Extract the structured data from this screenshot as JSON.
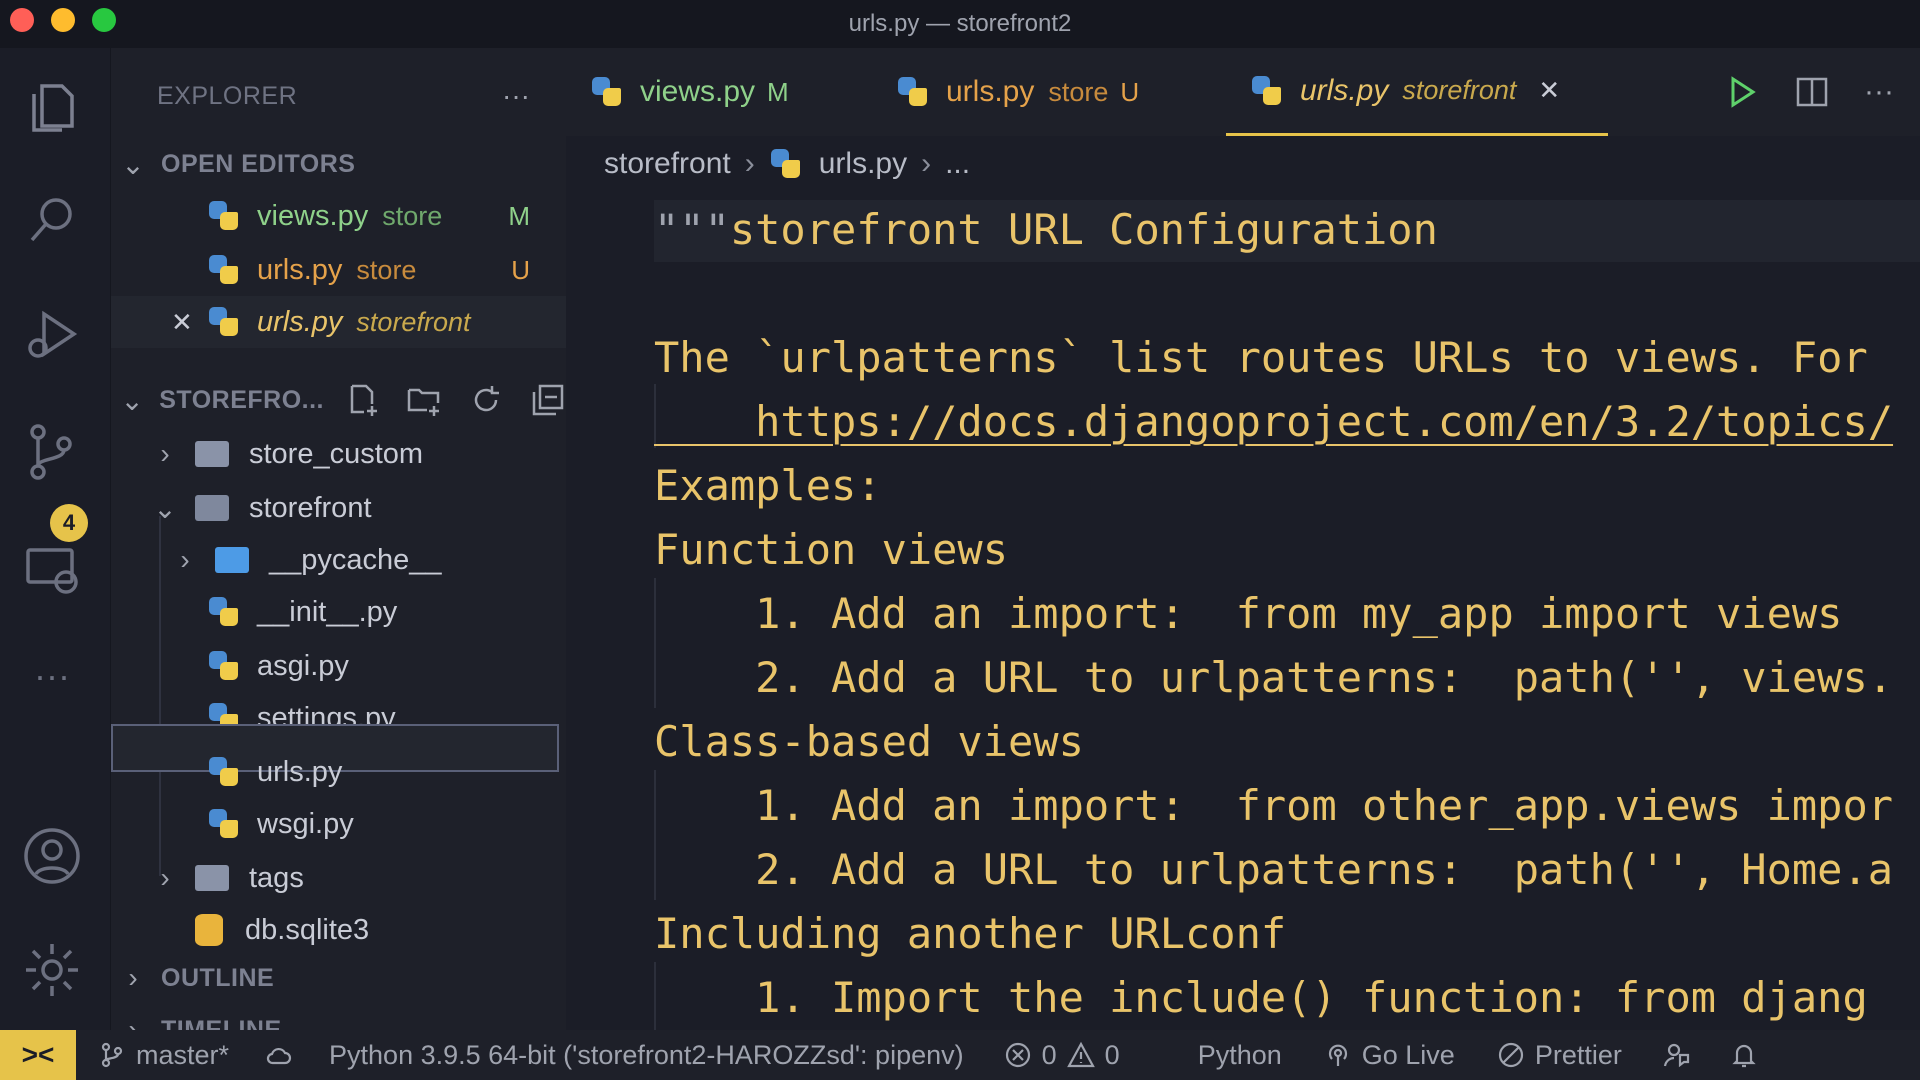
{
  "window": {
    "title": "urls.py — storefront2"
  },
  "activity": {
    "source_control_badge": "4"
  },
  "sidebar": {
    "title": "EXPLORER",
    "more": "···",
    "open_editors_header": "OPEN EDITORS",
    "open_editors": [
      {
        "name": "views.py",
        "folder": "store",
        "status": "M"
      },
      {
        "name": "urls.py",
        "folder": "store",
        "status": "U"
      },
      {
        "name": "urls.py",
        "folder": "storefront",
        "close": "✕"
      }
    ],
    "project_header": "STOREFRO...",
    "tree": [
      {
        "label": "store_custom"
      },
      {
        "label": "storefront"
      },
      {
        "label": "__pycache__"
      },
      {
        "label": "__init__.py"
      },
      {
        "label": "asgi.py"
      },
      {
        "label": "settings.py"
      },
      {
        "label": "urls.py"
      },
      {
        "label": "wsgi.py"
      },
      {
        "label": "tags"
      },
      {
        "label": "db.sqlite3"
      }
    ],
    "outline_header": "OUTLINE",
    "timeline_header": "TIMELINE"
  },
  "tabs": [
    {
      "name": "views.py",
      "status": "M"
    },
    {
      "name": "urls.py",
      "folder": "store",
      "status": "U"
    },
    {
      "name": "urls.py",
      "folder": "storefront",
      "close": "✕"
    }
  ],
  "tab_actions": {
    "more": "···"
  },
  "breadcrumb": {
    "folder": "storefront",
    "file": "urls.py",
    "more": "..."
  },
  "editor": {
    "lines": [
      "storefront URL Configuration",
      "",
      "The `urlpatterns` list routes URLs to views. For",
      "    https://docs.djangoproject.com/en/3.2/topics/",
      "Examples:",
      "Function views",
      "    1. Add an import:  from my_app import views",
      "    2. Add a URL to urlpatterns:  path('', views.",
      "Class-based views",
      "    1. Add an import:  from other_app.views impor",
      "    2. Add a URL to urlpatterns:  path('', Home.a",
      "Including another URLconf",
      "    1. Import the include() function: from djang"
    ],
    "docstring_open": "\"\"\""
  },
  "statusbar": {
    "branch": "master*",
    "interpreter": "Python 3.9.5 64-bit ('storefront2-HAROZZsd': pipenv)",
    "errors": "0",
    "warnings": "0",
    "language": "Python",
    "go_live": "Go Live",
    "prettier": "Prettier"
  },
  "colors": {
    "accent": "#e6c34a",
    "modified": "#8fd18a",
    "untracked": "#e5a24a"
  }
}
